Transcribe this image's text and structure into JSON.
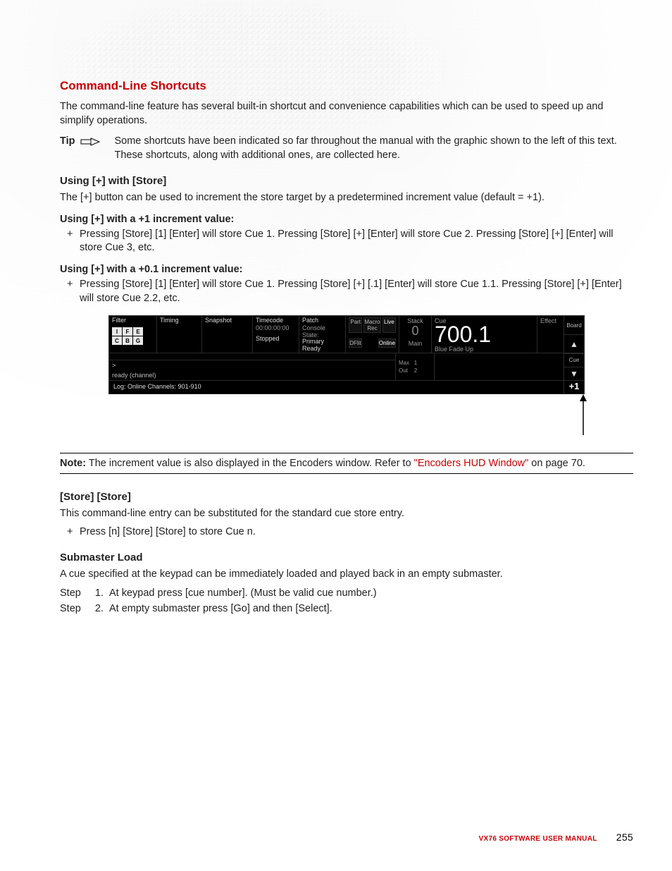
{
  "headings": {
    "section": "Command-Line Shortcuts",
    "using_plus_store": "Using [+] with [Store]",
    "inc_plus1": "Using [+] with a +1 increment value:",
    "inc_plus01": "Using [+] with a +0.1 increment value:",
    "store_store": "[Store] [Store]",
    "submaster_load": "Submaster Load"
  },
  "paragraphs": {
    "intro": "The command-line feature has several built-in shortcut and convenience capabilities which can be used to speed up and simplify operations.",
    "tip_label": "Tip",
    "tip_text": "Some shortcuts have been indicated so far throughout the manual with the graphic shown to the left of this text. These shortcuts, along with additional ones, are collected here.",
    "plus_intro": "The [+] button can be used to increment the store target by a predetermined increment value (default = +1).",
    "inc1_item": "Pressing [Store] [1] [Enter] will store Cue 1. Pressing [Store] [+] [Enter] will store Cue 2. Pressing [Store] [+] [Enter] will store Cue 3, etc.",
    "inc01_item": "Pressing [Store] [1] [Enter] will store Cue 1. Pressing [Store] [+] [.1] [Enter] will store Cue 1.1. Pressing [Store] [+] [Enter] will store Cue 2.2, etc.",
    "note_label": "Note:",
    "note_text_pre": "The increment value is also displayed in the Encoders window. Refer to ",
    "note_link": "\"Encoders HUD Window\"",
    "note_text_post": " on page 70.",
    "store_store_text": "This command-line entry can be substituted for the standard cue store entry.",
    "store_store_item": "Press [n] [Store] [Store] to store Cue n.",
    "submaster_text": "A cue specified at the keypad can be immediately loaded and played back in an empty submaster.",
    "step_label": "Step",
    "step1_n": "1.",
    "step1": "At keypad press [cue number]. (Must be valid cue number.)",
    "step2_n": "2.",
    "step2": "At empty submaster press [Go] and then [Select]."
  },
  "console": {
    "filter_label": "Filter",
    "filter_cells": [
      "I",
      "F",
      "E",
      "C",
      "B",
      "G"
    ],
    "timing": "Timing",
    "snapshot": "Snapshot",
    "timecode_label": "Timecode",
    "timecode_value": "00:00:00:00",
    "timecode_status": "Stopped",
    "patch_label": "Patch",
    "console_state_label": "Console State:",
    "console_state_primary": "Primary",
    "console_state_ready": "Ready",
    "flag_part": "Part",
    "flag_macro": "Macro Rec",
    "flag_live": "Live",
    "flag_dflt": "DFlit",
    "flag_online": "Online",
    "stack_label": "Stack",
    "stack_value": "0",
    "stack_main": "Main",
    "cue_label": "Cue",
    "cue_value": "700.1",
    "cue_name": "Blue Fade Up",
    "effect": "Effect",
    "side_board": "Board",
    "side_cue": "Cue",
    "max_label": "Max",
    "max_val": "1",
    "out_label": "Out",
    "out_val": "2",
    "prompt": ">",
    "ready": "ready (channel)",
    "log": "Log: Online Channels: 901-910",
    "plusone": "+1"
  },
  "footer": {
    "manual": "VX76 SOFTWARE USER MANUAL",
    "page": "255"
  }
}
